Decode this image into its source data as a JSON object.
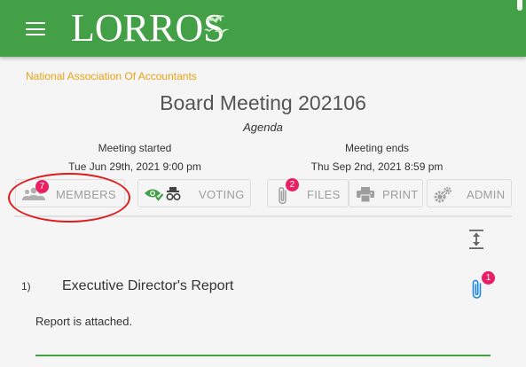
{
  "app": {
    "logo_text": "LORROS"
  },
  "header": {
    "organization": "National Association Of Accountants",
    "title": "Board Meeting 202106",
    "subtitle": "Agenda"
  },
  "meeting": {
    "start_label": "Meeting started",
    "start_value": "Tue Jun 29th, 2021 9:00 pm",
    "end_label": "Meeting ends",
    "end_value": "Thu Sep 2nd, 2021 8:59 pm"
  },
  "tabs": {
    "members": {
      "label": "MEMBERS",
      "badge": "7",
      "icon": "people-icon"
    },
    "voting": {
      "label": "VOTING",
      "icon": "eye-check-icon"
    },
    "files": {
      "label": "FILES",
      "badge": "2",
      "icon": "paperclip-icon"
    },
    "print": {
      "label": "PRINT",
      "icon": "printer-icon"
    },
    "admin": {
      "label": "ADMIN",
      "icon": "gears-icon"
    }
  },
  "agenda": {
    "items": [
      {
        "number": "1)",
        "title": "Executive Director's Report",
        "attachments_badge": "1",
        "body": "Report is attached."
      }
    ]
  },
  "colors": {
    "brand": "#43a047",
    "org": "#e6a317",
    "badge": "#e91e63",
    "highlight": "#e01b1b",
    "link": "#1e88e5"
  }
}
